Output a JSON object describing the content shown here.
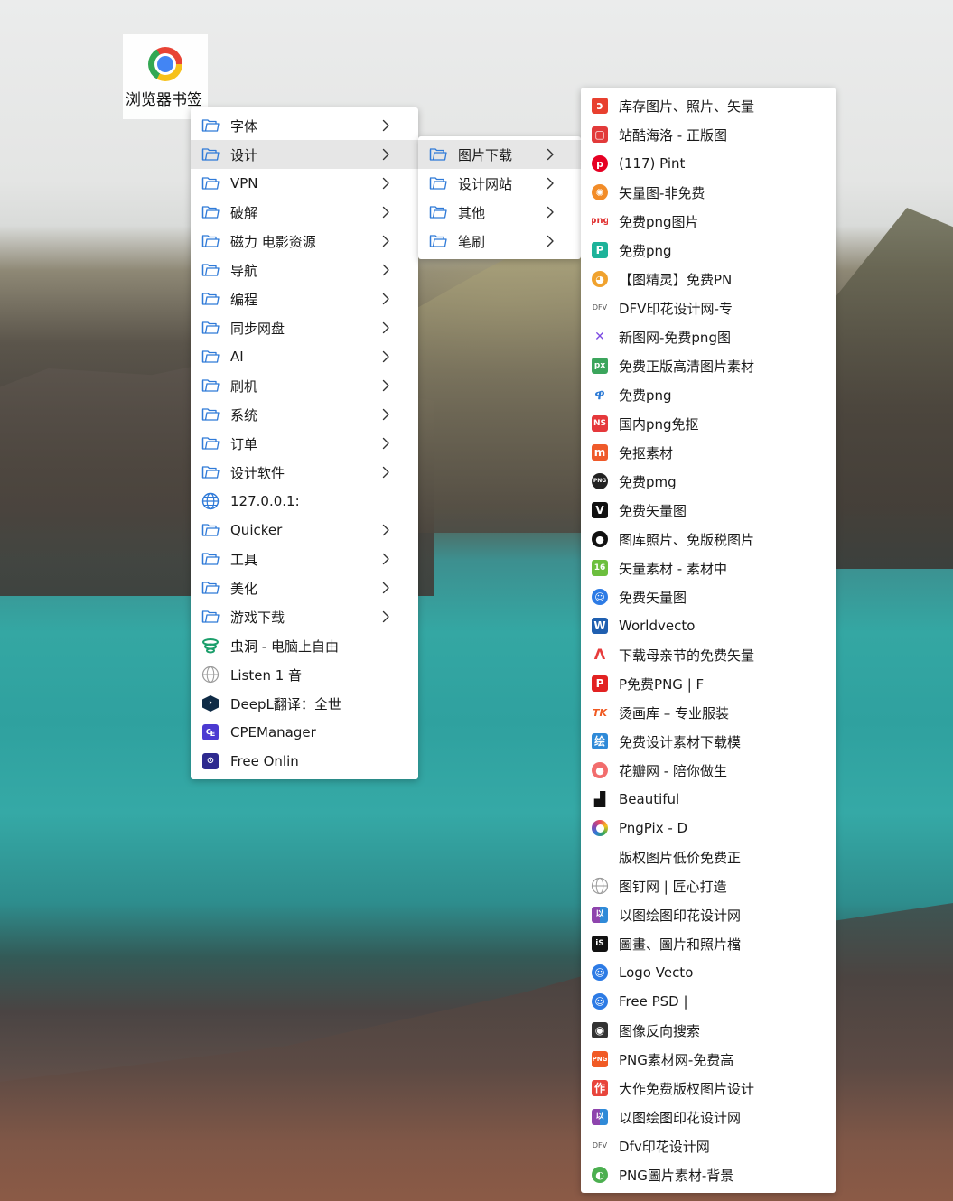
{
  "desktop": {
    "shortcut_label": "浏览器书签"
  },
  "menu_level1": [
    {
      "label": "字体",
      "icon": "folder-icon",
      "submenu": true
    },
    {
      "label": "设计",
      "icon": "folder-icon",
      "submenu": true,
      "active": true
    },
    {
      "label": "VPN",
      "icon": "folder-icon",
      "submenu": true
    },
    {
      "label": "破解",
      "icon": "folder-icon",
      "submenu": true
    },
    {
      "label": "磁力 电影资源",
      "icon": "folder-icon",
      "submenu": true
    },
    {
      "label": "导航",
      "icon": "folder-icon",
      "submenu": true
    },
    {
      "label": "编程",
      "icon": "folder-icon",
      "submenu": true
    },
    {
      "label": "同步网盘",
      "icon": "folder-icon",
      "submenu": true
    },
    {
      "label": "AI",
      "icon": "folder-icon",
      "submenu": true
    },
    {
      "label": "刷机",
      "icon": "folder-icon",
      "submenu": true
    },
    {
      "label": "系统",
      "icon": "folder-icon",
      "submenu": true
    },
    {
      "label": "订单",
      "icon": "folder-icon",
      "submenu": true
    },
    {
      "label": "设计软件",
      "icon": "folder-icon",
      "submenu": true
    },
    {
      "label": "127.0.0.1:",
      "icon": "globe-icon",
      "submenu": false
    },
    {
      "label": "Quicker",
      "icon": "folder-icon",
      "submenu": true
    },
    {
      "label": "工具",
      "icon": "folder-icon",
      "submenu": true
    },
    {
      "label": "美化",
      "icon": "folder-icon",
      "submenu": true
    },
    {
      "label": "游戏下载",
      "icon": "folder-icon",
      "submenu": true
    },
    {
      "label": "虫洞 - 电脑上自由",
      "icon": "wormhole-favicon",
      "submenu": false
    },
    {
      "label": "Listen 1 音",
      "icon": "globe-gray-icon",
      "submenu": false
    },
    {
      "label": "DeepL翻译：全世",
      "icon": "deepl-favicon",
      "submenu": false
    },
    {
      "label": "CPEManager",
      "icon": "cpe-favicon",
      "submenu": false
    },
    {
      "label": "Free Onlin",
      "icon": "free-online-favicon",
      "submenu": false
    }
  ],
  "menu_level2": [
    {
      "label": "图片下载",
      "icon": "folder-icon",
      "submenu": true,
      "active": true
    },
    {
      "label": "设计网站",
      "icon": "folder-icon",
      "submenu": true
    },
    {
      "label": "其他",
      "icon": "folder-icon",
      "submenu": true
    },
    {
      "label": "笔刷",
      "icon": "folder-icon",
      "submenu": true
    }
  ],
  "menu_level3": [
    {
      "label": "库存图片、照片、矢量",
      "icon": "red-square-favicon",
      "color": "#e8402f",
      "glyph": "ɔ"
    },
    {
      "label": "站酷海洛 - 正版图",
      "icon": "red-frame-favicon",
      "color": "#e23a3a",
      "glyph": "▢"
    },
    {
      "label": "(117) Pint",
      "icon": "pinterest-favicon",
      "color": "#e60023",
      "glyph": "p"
    },
    {
      "label": "矢量图-非免费",
      "icon": "orange-gear-favicon",
      "color": "#f28c28",
      "glyph": "✺"
    },
    {
      "label": "免费png图片",
      "icon": "png-text-favicon",
      "color": "#e03131",
      "glyph": "png"
    },
    {
      "label": "免费png",
      "icon": "teal-p-favicon",
      "color": "#1db39a",
      "glyph": "P"
    },
    {
      "label": "【图精灵】免费PN",
      "icon": "tiger-favicon",
      "color": "#f0a22e",
      "glyph": "◕"
    },
    {
      "label": "DFV印花设计网-专",
      "icon": "dfv-text-favicon",
      "color": "#555555",
      "glyph": "DFV"
    },
    {
      "label": "新图网-免费png图",
      "icon": "colorful-x-favicon",
      "color": "#7b4ae2",
      "glyph": "✕"
    },
    {
      "label": "免费正版高清图片素材",
      "icon": "px-favicon",
      "color": "#3ba55c",
      "glyph": "px"
    },
    {
      "label": "免费png",
      "icon": "blue-leaf-favicon",
      "color": "#2b7ad6",
      "glyph": "ዋ"
    },
    {
      "label": "国内png免抠",
      "icon": "red-ns-favicon",
      "color": "#e5383b",
      "glyph": "NS"
    },
    {
      "label": "免抠素材",
      "icon": "orange-m-favicon",
      "color": "#ef5a2a",
      "glyph": "m"
    },
    {
      "label": "免费pmg",
      "icon": "png-circle-favicon",
      "color": "#222222",
      "glyph": "PNG"
    },
    {
      "label": "免费矢量图",
      "icon": "vecteezy-favicon",
      "color": "#111111",
      "glyph": "V"
    },
    {
      "label": "图库照片、免版税图片",
      "icon": "black-dot-favicon",
      "color": "#111111",
      "glyph": "●"
    },
    {
      "label": "矢量素材 - 素材中",
      "icon": "green-16-favicon",
      "color": "#6cbf3e",
      "glyph": "16"
    },
    {
      "label": "免费矢量图",
      "icon": "blue-robot-favicon",
      "color": "#2d7be5",
      "glyph": "☺"
    },
    {
      "label": "Worldvecto",
      "icon": "w-favicon",
      "color": "#1f5fb0",
      "glyph": "W"
    },
    {
      "label": "下载母亲节的免费矢量",
      "icon": "red-a-favicon",
      "color": "#e73c3c",
      "glyph": "Λ"
    },
    {
      "label": "P免费PNG | F",
      "icon": "red-p-favicon",
      "color": "#e22222",
      "glyph": "P"
    },
    {
      "label": "烫画库 – 专业服装",
      "icon": "tk-favicon",
      "color": "#f05a22",
      "glyph": "TK"
    },
    {
      "label": "免费设计素材下载模",
      "icon": "blue-square-favicon",
      "color": "#2f8ad8",
      "glyph": "绘"
    },
    {
      "label": "花瓣网 - 陪你做生",
      "icon": "huaban-favicon",
      "color": "#f26d6d",
      "glyph": "●"
    },
    {
      "label": "Beautiful",
      "icon": "unsplash-favicon",
      "color": "#111111",
      "glyph": "▟"
    },
    {
      "label": "PngPix - D",
      "icon": "rainbow-ring-favicon",
      "color": "#e84a5f",
      "glyph": "◎"
    },
    {
      "label": "版权图片低价免费正",
      "icon": "blank-favicon",
      "color": "#ffffff",
      "glyph": ""
    },
    {
      "label": "图钉网 | 匠心打造",
      "icon": "globe-gray-icon",
      "color": "#9a9a9a",
      "glyph": ""
    },
    {
      "label": "以图绘图印花设计网",
      "icon": "multicolor-grid-favicon",
      "color": "#8e44ad",
      "glyph": "以"
    },
    {
      "label": "圖畫、圖片和照片檔",
      "icon": "istock-favicon",
      "color": "#111111",
      "glyph": "iS"
    },
    {
      "label": "Logo Vecto",
      "icon": "blue-robot-favicon",
      "color": "#2d7be5",
      "glyph": "☺"
    },
    {
      "label": "Free PSD |",
      "icon": "blue-robot-favicon",
      "color": "#2d7be5",
      "glyph": "☺"
    },
    {
      "label": "图像反向搜索",
      "icon": "camera-favicon",
      "color": "#333333",
      "glyph": "◉"
    },
    {
      "label": "PNG素材网-免费高",
      "icon": "png-orange-favicon",
      "color": "#f15a24",
      "glyph": "PNG"
    },
    {
      "label": "大作免费版权图片设计",
      "icon": "red-zuo-favicon",
      "color": "#e8453c",
      "glyph": "作"
    },
    {
      "label": "以图绘图印花设计网",
      "icon": "multicolor-grid-favicon",
      "color": "#8e44ad",
      "glyph": "以"
    },
    {
      "label": "Dfv印花设计网",
      "icon": "dfv-text-favicon",
      "color": "#555555",
      "glyph": "DFV"
    },
    {
      "label": "PNG圖片素材-背景",
      "icon": "green-swirl-favicon",
      "color": "#4caf50",
      "glyph": "◐"
    }
  ]
}
